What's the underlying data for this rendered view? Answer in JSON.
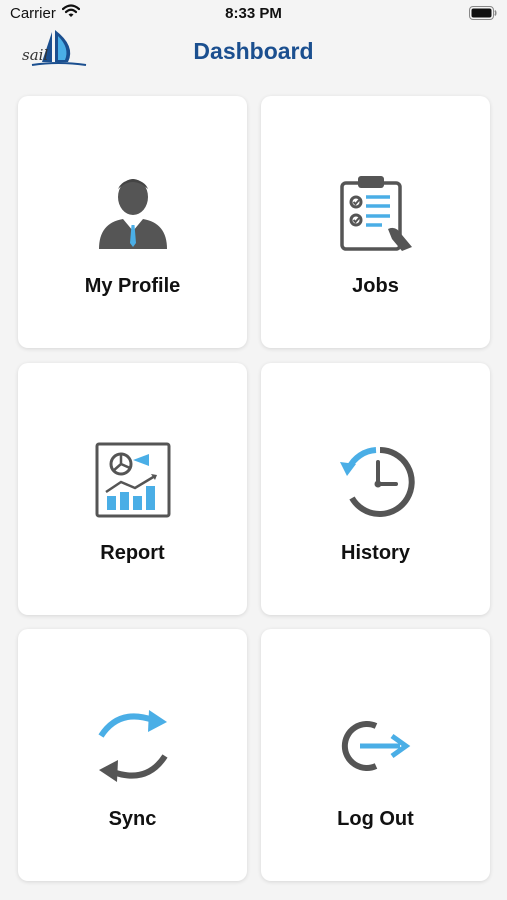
{
  "status_bar": {
    "carrier": "Carrier",
    "time": "8:33 PM"
  },
  "header": {
    "logo_text": "sail",
    "title": "Dashboard"
  },
  "tiles": [
    {
      "label": "My Profile",
      "icon": "user-profile-icon"
    },
    {
      "label": "Jobs",
      "icon": "clipboard-checklist-icon"
    },
    {
      "label": "Report",
      "icon": "report-chart-icon"
    },
    {
      "label": "History",
      "icon": "history-clock-icon"
    },
    {
      "label": "Sync",
      "icon": "sync-arrows-icon"
    },
    {
      "label": "Log Out",
      "icon": "logout-icon"
    }
  ],
  "colors": {
    "title": "#1b4f8f",
    "accent_blue": "#4aaee6",
    "icon_gray": "#555555",
    "background": "#f4f4f4",
    "tile_background": "#ffffff"
  }
}
